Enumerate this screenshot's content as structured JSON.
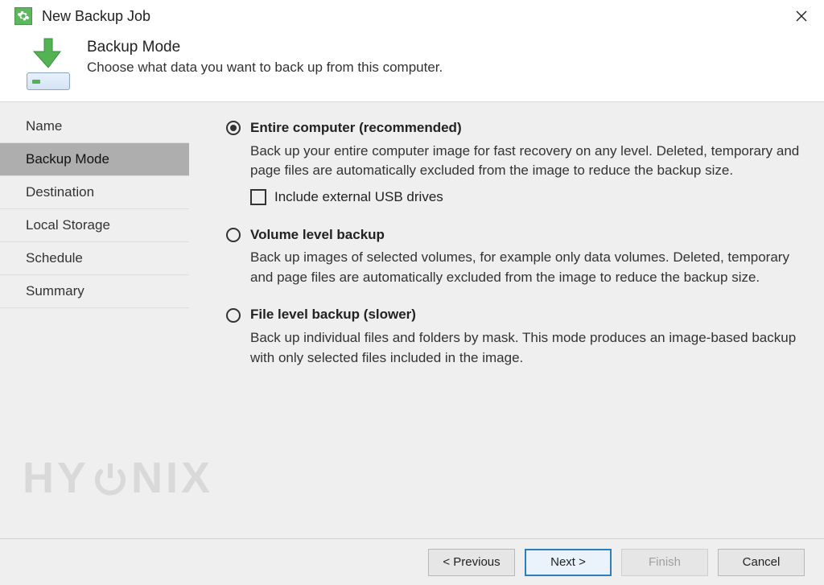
{
  "window": {
    "title": "New Backup Job"
  },
  "header": {
    "title": "Backup Mode",
    "subtitle": "Choose what data you want to back up from this computer."
  },
  "sidebar": {
    "items": [
      {
        "label": "Name",
        "active": false
      },
      {
        "label": "Backup Mode",
        "active": true
      },
      {
        "label": "Destination",
        "active": false
      },
      {
        "label": "Local Storage",
        "active": false
      },
      {
        "label": "Schedule",
        "active": false
      },
      {
        "label": "Summary",
        "active": false
      }
    ]
  },
  "options": {
    "entire": {
      "title": "Entire computer (recommended)",
      "desc": "Back up your entire computer image for fast recovery on any level. Deleted, temporary and page files are automatically excluded from the image to reduce the backup size.",
      "include_usb_label": "Include external USB drives",
      "selected": true
    },
    "volume": {
      "title": "Volume level backup",
      "desc": "Back up images of selected volumes, for example only data volumes. Deleted, temporary and page files are automatically excluded from the image to reduce the backup size.",
      "selected": false
    },
    "file": {
      "title": "File level backup (slower)",
      "desc": "Back up individual files and folders by mask. This mode produces an image-based backup with only selected files included in the image.",
      "selected": false
    }
  },
  "buttons": {
    "previous": "< Previous",
    "next": "Next >",
    "finish": "Finish",
    "cancel": "Cancel"
  },
  "watermark": {
    "left": "HY",
    "right": "NIX"
  }
}
